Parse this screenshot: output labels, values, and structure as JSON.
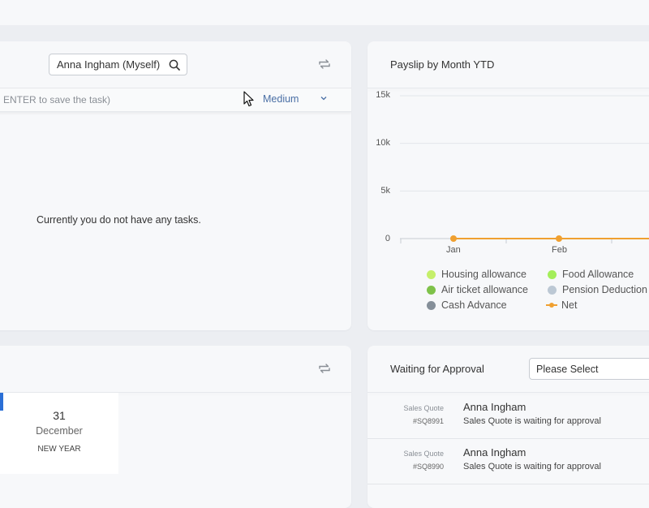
{
  "tasks": {
    "user_select_value": "Anna Ingham (Myself)",
    "input_hint": "ENTER to save the task)",
    "priority": "Medium",
    "empty_message": "Currently you do not have any tasks."
  },
  "payslip": {
    "title": "Payslip by Month YTD"
  },
  "chart_data": {
    "type": "line",
    "title": "Payslip by Month YTD",
    "categories": [
      "Jan",
      "Feb"
    ],
    "y_ticks": [
      "15k",
      "10k",
      "5k",
      "0"
    ],
    "ylim": [
      0,
      15000
    ],
    "grid": true,
    "legend_placement": "bottom",
    "legend": [
      {
        "name": "Housing allowance",
        "color": "#c5ef6a",
        "marker": "dot"
      },
      {
        "name": "Food Allowance",
        "color": "#a4ee5a",
        "marker": "dot"
      },
      {
        "name": "Air ticket allowance",
        "color": "#7fc24a",
        "marker": "dot"
      },
      {
        "name": "Pension Deduction",
        "color": "#bcc8d4",
        "marker": "dot"
      },
      {
        "name": "Cash Advance",
        "color": "#858f99",
        "marker": "dot"
      },
      {
        "name": "Net",
        "color": "#f0a030",
        "marker": "line"
      }
    ],
    "series": [
      {
        "name": "Net",
        "values": [
          0,
          0
        ]
      }
    ]
  },
  "events": {
    "day": "31",
    "month": "December",
    "name": "NEW YEAR"
  },
  "approval": {
    "title": "Waiting for Approval",
    "select_value": "Please Select",
    "rows": [
      {
        "type": "Sales Quote",
        "ref": "#SQ8991",
        "name": "Anna Ingham",
        "desc": "Sales Quote is waiting for approval"
      },
      {
        "type": "Sales Quote",
        "ref": "#SQ8990",
        "name": "Anna Ingham",
        "desc": "Sales Quote is waiting for approval"
      }
    ]
  },
  "colors": {
    "accent_blue": "#2b6fd6",
    "priority_text": "#4a6fa5",
    "net_line": "#f0a030"
  }
}
